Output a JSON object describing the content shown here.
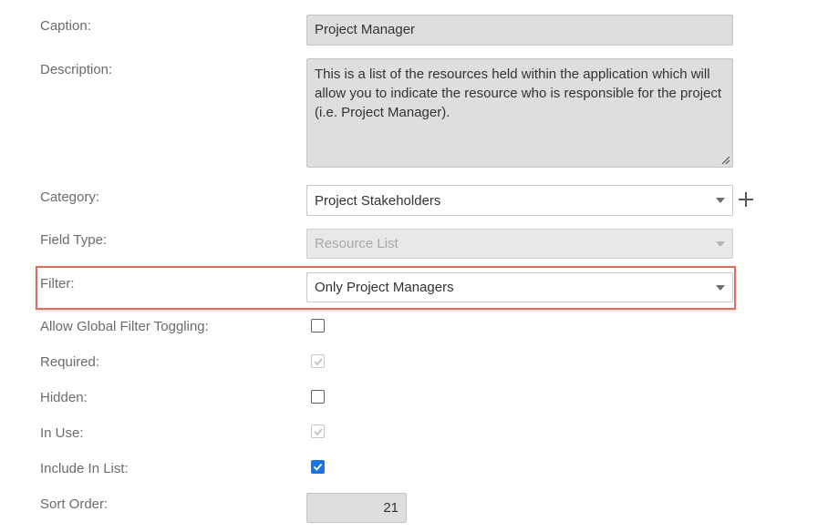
{
  "form": {
    "caption": {
      "label": "Caption:",
      "value": "Project Manager"
    },
    "description": {
      "label": "Description:",
      "value": "This is a list of the resources held within the application which will allow you to indicate the resource who is responsible for the project (i.e. Project Manager)."
    },
    "category": {
      "label": "Category:",
      "value": "Project Stakeholders"
    },
    "field_type": {
      "label": "Field Type:",
      "value": "Resource List"
    },
    "filter": {
      "label": "Filter:",
      "value": "Only Project Managers"
    },
    "allow_global_filter_toggling": {
      "label": "Allow Global Filter Toggling:",
      "checked": false,
      "disabled": false
    },
    "required": {
      "label": "Required:",
      "checked": true,
      "disabled": true
    },
    "hidden": {
      "label": "Hidden:",
      "checked": false,
      "disabled": false
    },
    "in_use": {
      "label": "In Use:",
      "checked": true,
      "disabled": true
    },
    "include_in_list": {
      "label": "Include In List:",
      "checked": true,
      "disabled": false
    },
    "sort_order": {
      "label": "Sort Order:",
      "value": "21"
    }
  },
  "icons": {
    "add_category": "plus-icon",
    "dropdown": "chevron-down-icon",
    "resize": "resize-grip-icon"
  },
  "colors": {
    "highlight_border": "#d9705c",
    "checkbox_checked": "#1a73e8",
    "readonly_bg": "#dedede"
  }
}
